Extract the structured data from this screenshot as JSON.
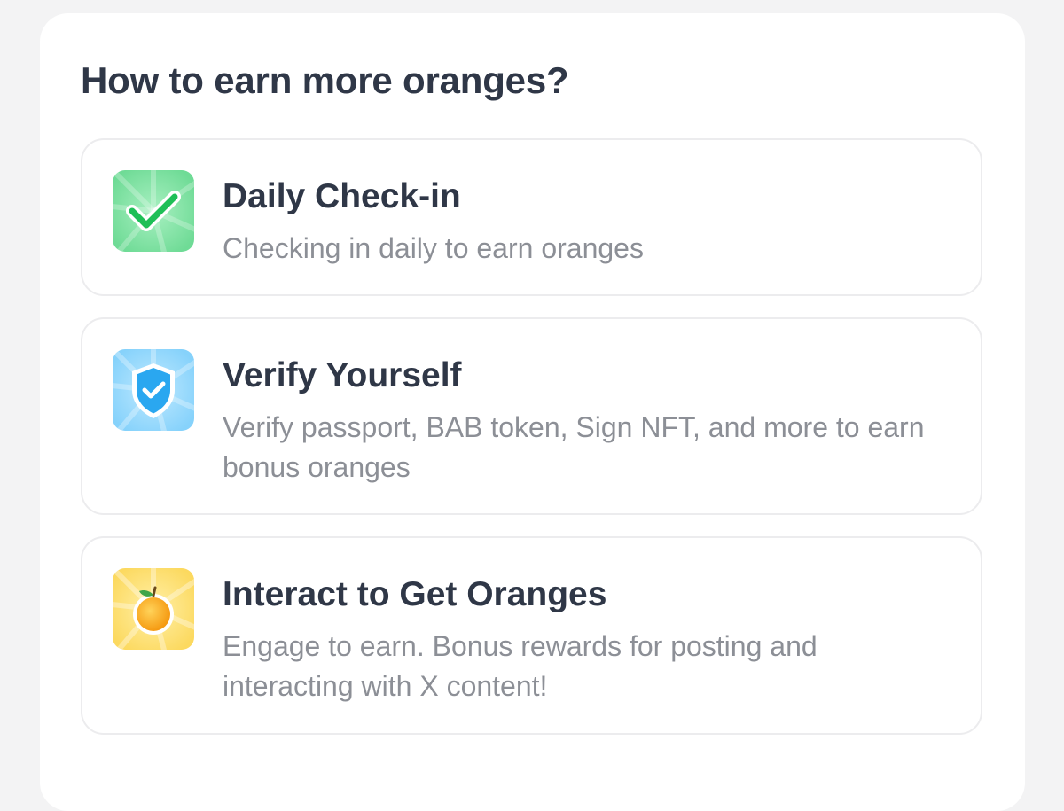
{
  "section": {
    "title": "How to earn more oranges?"
  },
  "tasks": [
    {
      "title": "Daily Check-in",
      "description": "Checking in daily to earn oranges",
      "icon": "checkmark-icon",
      "icon_bg": "#7ee2a3",
      "icon_accent": "#22c05a"
    },
    {
      "title": "Verify Yourself",
      "description": "Verify passport, BAB token, Sign NFT, and more to earn bonus oranges",
      "icon": "shield-check-icon",
      "icon_bg": "#8fd6fb",
      "icon_accent": "#2aa7f0"
    },
    {
      "title": "Interact to Get Oranges",
      "description": "Engage to earn. Bonus rewards for posting and interacting with X content!",
      "icon": "orange-fruit-icon",
      "icon_bg": "#fde07a",
      "icon_accent": "#f7a21a"
    }
  ]
}
